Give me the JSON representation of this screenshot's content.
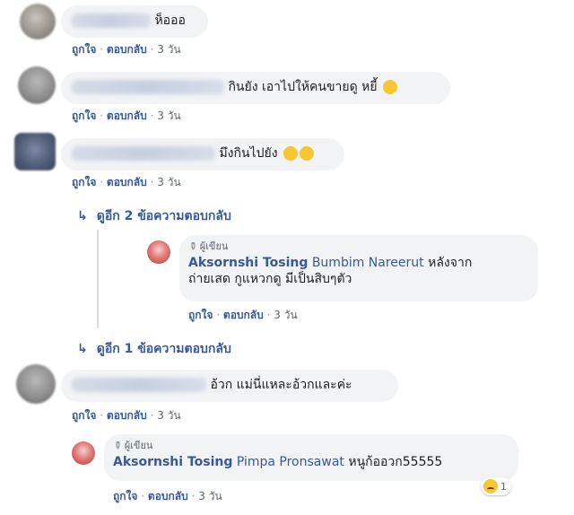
{
  "actions": {
    "like": "ถูกใจ",
    "reply": "ตอบกลับ",
    "separator": "·"
  },
  "comments": [
    {
      "text": "ห็อออ",
      "emoji": "",
      "time": "3 วัน"
    },
    {
      "text": "กินยัง เอาไปให้คนขายดู หยี้",
      "emoji": "😂",
      "time": "3 วัน"
    },
    {
      "text": "มึงกินไปยัง",
      "emoji": "🤣🤣",
      "time": "3 วัน",
      "more_replies_top": "ดูอีก 2 ข้อความตอบกลับ",
      "reply": {
        "author_tag": "ผู้เขียน",
        "author": "Aksornshi Tosing",
        "mention": "Bumbim Nareerut",
        "text_line1": "หลังจาก",
        "text_line2": "ถ่ายเสด กูแหวกดู มีเป็นสิบๆตัว",
        "time": "3 วัน"
      },
      "more_replies_bottom": "ดูอีก 1 ข้อความตอบกลับ"
    },
    {
      "text": "อ้วก แม่นี่แหละอ้วกและค่ะ",
      "emoji": "",
      "time": "3 วัน",
      "reply": {
        "author_tag": "ผู้เขียน",
        "author": "Aksornshi Tosing",
        "mention": "Pimpa Pronsawat",
        "text": "หนูก้ออวก55555",
        "time": "3 วัน",
        "reaction_count": "1",
        "reaction_icon": "sad-face-icon"
      }
    }
  ],
  "colors": {
    "link": "#385898",
    "bubble": "#f2f3f5",
    "meta": "#606770"
  }
}
